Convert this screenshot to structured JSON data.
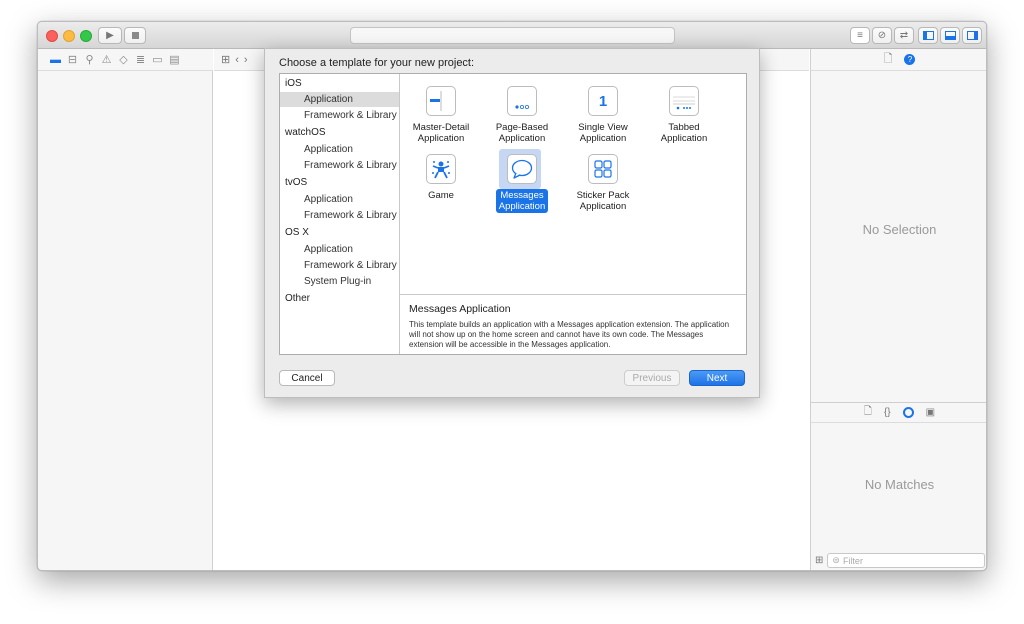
{
  "titlebar": {
    "run_icon": "play-icon",
    "stop_icon": "stop-icon"
  },
  "navigator_tabs": [
    "folder-icon",
    "hierarchy-icon",
    "search-icon",
    "warning-icon",
    "test-icon",
    "debug-icon",
    "breakpoint-icon",
    "report-icon"
  ],
  "inspector": {
    "no_selection": "No Selection"
  },
  "library": {
    "no_matches": "No Matches",
    "filter_placeholder": "Filter"
  },
  "sheet": {
    "title": "Choose a template for your new project:",
    "platforms": [
      {
        "group": "iOS",
        "items": [
          "Application",
          "Framework & Library"
        ]
      },
      {
        "group": "watchOS",
        "items": [
          "Application",
          "Framework & Library"
        ]
      },
      {
        "group": "tvOS",
        "items": [
          "Application",
          "Framework & Library"
        ]
      },
      {
        "group": "OS X",
        "items": [
          "Application",
          "Framework & Library",
          "System Plug-in"
        ]
      },
      {
        "group": "Other",
        "items": []
      }
    ],
    "selected_platform": "iOS / Application",
    "templates": [
      {
        "label": "Master-Detail\nApplication",
        "icon": "master-detail-icon"
      },
      {
        "label": "Page-Based\nApplication",
        "icon": "page-based-icon"
      },
      {
        "label": "Single View\nApplication",
        "icon": "single-view-icon",
        "glyph": "1"
      },
      {
        "label": "Tabbed\nApplication",
        "icon": "tabbed-icon"
      },
      {
        "label": "Game",
        "icon": "game-icon"
      },
      {
        "label": "Messages\nApplication",
        "icon": "messages-icon",
        "selected": true
      },
      {
        "label": "Sticker Pack\nApplication",
        "icon": "sticker-pack-icon"
      }
    ],
    "description": {
      "title": "Messages Application",
      "text": "This template builds an application with a Messages application extension. The application will not show up on the home screen and cannot have its own code. The Messages extension will be accessible in the Messages application."
    },
    "buttons": {
      "cancel": "Cancel",
      "previous": "Previous",
      "next": "Next"
    }
  },
  "colors": {
    "accent": "#1a74e8",
    "close": "#fc605c",
    "minimize": "#fdbc40",
    "zoom": "#34c84a"
  }
}
